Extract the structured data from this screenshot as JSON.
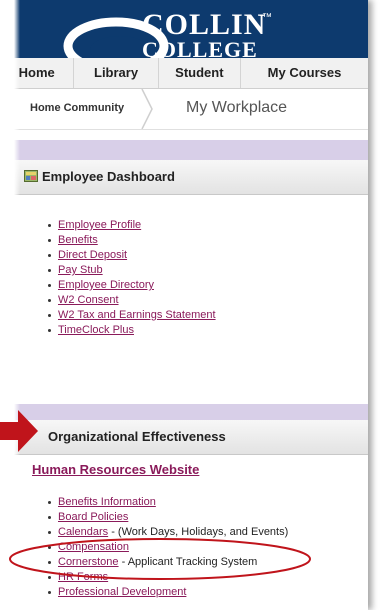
{
  "brand": {
    "line1": "COLLIN",
    "line2": "COLLEGE",
    "tm": "™",
    "colors": {
      "banner": "#0d3a6e",
      "link": "#8a1a5a",
      "accent_lavender": "#d8cfe8",
      "annotation_red": "#c0141b"
    }
  },
  "nav": {
    "tabs": [
      {
        "label": "Home"
      },
      {
        "label": "Library"
      },
      {
        "label": "Student"
      },
      {
        "label": "My Courses"
      }
    ]
  },
  "breadcrumb": {
    "parent": "Home Community",
    "current": "My Workplace"
  },
  "employee_dashboard": {
    "title": "Employee Dashboard",
    "icon": "dashboard-icon",
    "links": [
      "Employee Profile",
      "Benefits",
      "Direct Deposit",
      "Pay Stub",
      "Employee Directory",
      "W2 Consent",
      "W2 Tax and Earnings Statement",
      "TimeClock Plus"
    ]
  },
  "org_effectiveness": {
    "title": "Organizational Effectiveness",
    "hr_website": "Human Resources Website",
    "items": [
      {
        "link": "Benefits Information",
        "suffix": ""
      },
      {
        "link": "Board Policies",
        "suffix": ""
      },
      {
        "link": "Calendars",
        "suffix": " - (Work Days, Holidays, and Events)"
      },
      {
        "link": "Compensation",
        "suffix": ""
      },
      {
        "link": "Cornerstone",
        "suffix": " - Applicant Tracking System"
      },
      {
        "link": "HR Forms",
        "suffix": ""
      },
      {
        "link": "Professional Development",
        "suffix": ""
      }
    ]
  },
  "annotations": {
    "arrow": "red-arrow-pointing-right",
    "highlight": "red-ellipse-around-cornerstone"
  }
}
